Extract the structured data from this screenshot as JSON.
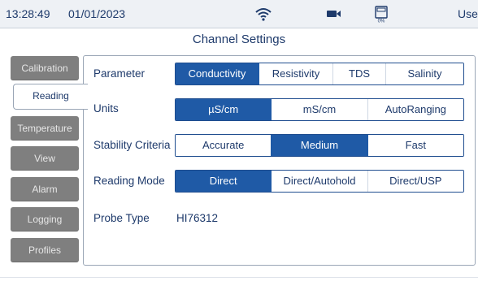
{
  "status": {
    "time": "13:28:49",
    "date": "01/01/2023",
    "user": "User",
    "memory_pct": "0%"
  },
  "header": {
    "title": "Channel Settings"
  },
  "sidebar": {
    "items": [
      {
        "label": "Calibration"
      },
      {
        "label": "Reading"
      },
      {
        "label": "Temperature"
      },
      {
        "label": "View"
      },
      {
        "label": "Alarm"
      },
      {
        "label": "Logging"
      },
      {
        "label": "Profiles"
      }
    ],
    "active": "Reading"
  },
  "settings": {
    "parameter": {
      "label": "Parameter",
      "options": [
        "Conductivity",
        "Resistivity",
        "TDS",
        "Salinity"
      ],
      "selected": "Conductivity"
    },
    "units": {
      "label": "Units",
      "options": [
        "µS/cm",
        "mS/cm",
        "AutoRanging"
      ],
      "selected": "µS/cm"
    },
    "stability": {
      "label": "Stability Criteria",
      "options": [
        "Accurate",
        "Medium",
        "Fast"
      ],
      "selected": "Medium"
    },
    "reading_mode": {
      "label": "Reading Mode",
      "options": [
        "Direct",
        "Direct/Autohold",
        "Direct/USP"
      ],
      "selected": "Direct"
    },
    "probe_type": {
      "label": "Probe Type",
      "value": "HI76312"
    }
  },
  "colors": {
    "accent": "#1f5aa6",
    "tab_inactive": "#7f7f7f",
    "text": "#1e3a6b"
  }
}
